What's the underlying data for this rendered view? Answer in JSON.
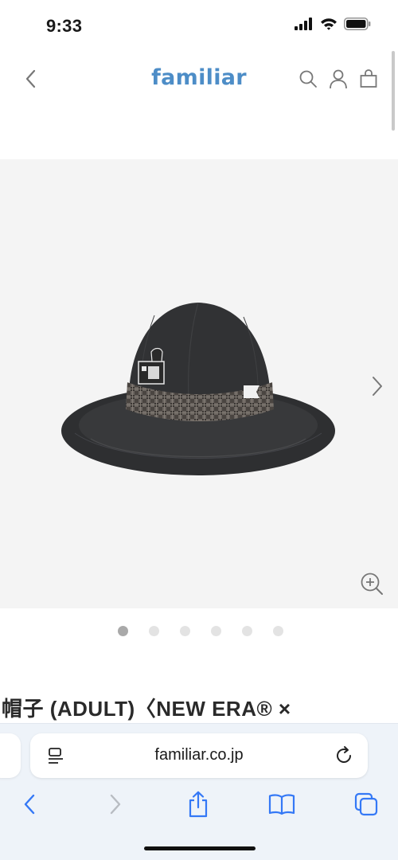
{
  "status_bar": {
    "time": "9:33",
    "icons": [
      "cellular-signal-icon",
      "wifi-icon",
      "battery-icon"
    ]
  },
  "header": {
    "logo": "familiar",
    "logo_color": "#4d8dc7",
    "icons": [
      "back-chevron-icon",
      "search-icon",
      "account-icon",
      "shopping-bag-icon"
    ]
  },
  "gallery": {
    "background": "#f4f4f4",
    "image": "black-bucket-hat-with-plaid-band",
    "image_count": 6,
    "active_index": 0
  },
  "product": {
    "title": "帽子 (ADULT)〈NEW ERA® ×"
  },
  "browser": {
    "url": "familiar.co.jp",
    "accent": "#3478f6",
    "toolbar_icons": [
      "back-icon",
      "forward-icon",
      "share-icon",
      "bookmarks-icon",
      "tabs-icon"
    ]
  }
}
